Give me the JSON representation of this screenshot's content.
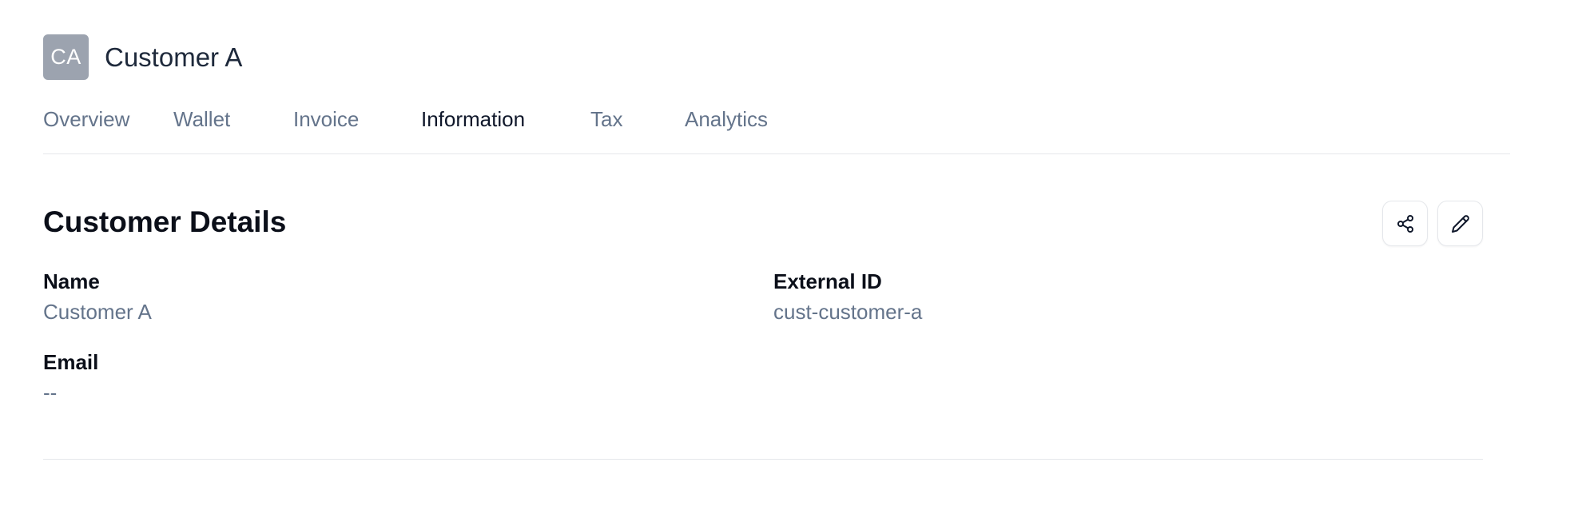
{
  "header": {
    "avatar_initials": "CA",
    "title": "Customer A"
  },
  "tabs": [
    {
      "label": "Overview",
      "active": false
    },
    {
      "label": "Wallet",
      "active": false
    },
    {
      "label": "Invoice",
      "active": false
    },
    {
      "label": "Information",
      "active": true
    },
    {
      "label": "Tax",
      "active": false
    },
    {
      "label": "Analytics",
      "active": false
    }
  ],
  "section": {
    "title": "Customer Details",
    "actions": {
      "share_icon": "share-icon",
      "edit_icon": "pencil-icon"
    }
  },
  "fields": {
    "name": {
      "label": "Name",
      "value": "Customer A"
    },
    "external_id": {
      "label": "External ID",
      "value": "cust-customer-a"
    },
    "email": {
      "label": "Email",
      "value": "--"
    }
  },
  "colors": {
    "avatar_bg": "#9ca3af",
    "muted_text": "#64748b",
    "active_text": "#0f172a",
    "divider": "#e5e7eb"
  }
}
